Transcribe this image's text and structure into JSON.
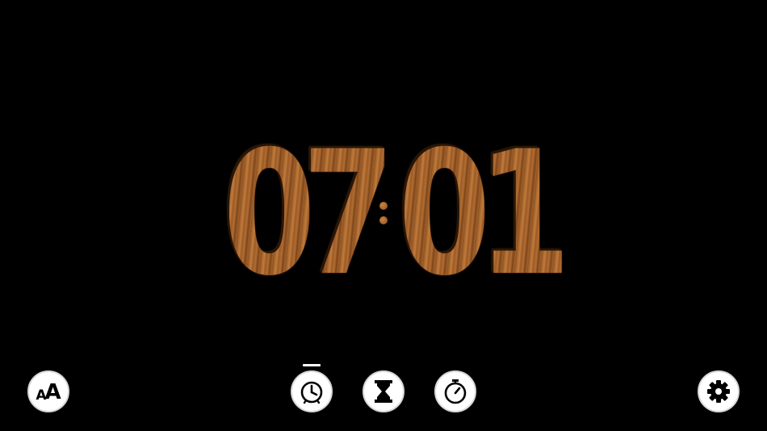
{
  "clock": {
    "hour_tens": "0",
    "hour_ones": "7",
    "minute_tens": "0",
    "minute_ones": "1"
  },
  "toolbar": {
    "font_size_small": "A",
    "font_size_large": "A",
    "active_mode": "clock",
    "modes": [
      {
        "name": "clock",
        "icon": "clock-icon"
      },
      {
        "name": "timer",
        "icon": "hourglass-icon"
      },
      {
        "name": "stopwatch",
        "icon": "stopwatch-icon"
      }
    ],
    "settings_icon": "gear-icon"
  },
  "colors": {
    "background": "#000000",
    "digit_wood": "#a9682f",
    "button_fill": "#ffffff"
  }
}
